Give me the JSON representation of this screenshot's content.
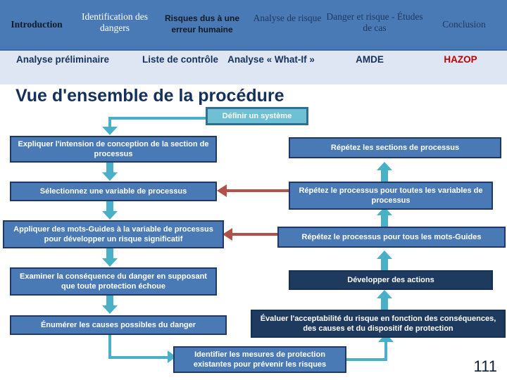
{
  "header": {
    "top_nav": [
      {
        "key": "introduction",
        "label": "Introduction"
      },
      {
        "key": "identification",
        "label": "Identification des dangers"
      },
      {
        "key": "risques",
        "label": "Risques dus à une erreur humaine"
      },
      {
        "key": "analyse_risque",
        "label": "Analyse de risque"
      },
      {
        "key": "danger_etudes",
        "label": "Danger et risque - Études de cas"
      },
      {
        "key": "conclusion",
        "label": "Conclusion"
      }
    ],
    "sub_nav": [
      {
        "key": "analyse_preliminaire",
        "label": "Analyse préliminaire"
      },
      {
        "key": "liste_controle",
        "label": "Liste de contrôle"
      },
      {
        "key": "what_if",
        "label": "Analyse « What-If »"
      },
      {
        "key": "amde",
        "label": "AMDE"
      },
      {
        "key": "hazop",
        "label": "HAZOP",
        "color": "#c00000"
      }
    ]
  },
  "title": "Vue d'ensemble de la procédure",
  "flow": {
    "define": "Définir un système",
    "left": [
      "Expliquer l'intension de conception de la section de processus",
      "Sélectionnez une variable de processus",
      "Appliquer des mots-Guides à la variable de processus pour développer un risque significatif",
      "Examiner la conséquence du danger en supposant que toute protection échoue",
      "Énumérer les causes possibles du danger"
    ],
    "right": [
      "Répétez les sections de processus",
      "Répétez le processus pour toutes les variables de processus",
      "Répétez le processus pour tous les mots-Guides",
      "Développer des actions",
      "Évaluer l'acceptabilité du risque en fonction des conséquences, des causes et du dispositif de protection"
    ],
    "bottom": "Identifier les mesures de protection existantes pour prévenir les risques"
  },
  "page_number": "111",
  "colors": {
    "header_blue": "#4a7ab5",
    "subheader_bg": "#dde6f2",
    "box_blue": "#4a7ab5",
    "box_navy": "#1f3a5f",
    "box_teal": "#6fc0d4",
    "arrow_teal": "#4ab0c8",
    "arrow_red": "#b4504a",
    "title_navy": "#14305c",
    "hazop_red": "#c00000"
  }
}
